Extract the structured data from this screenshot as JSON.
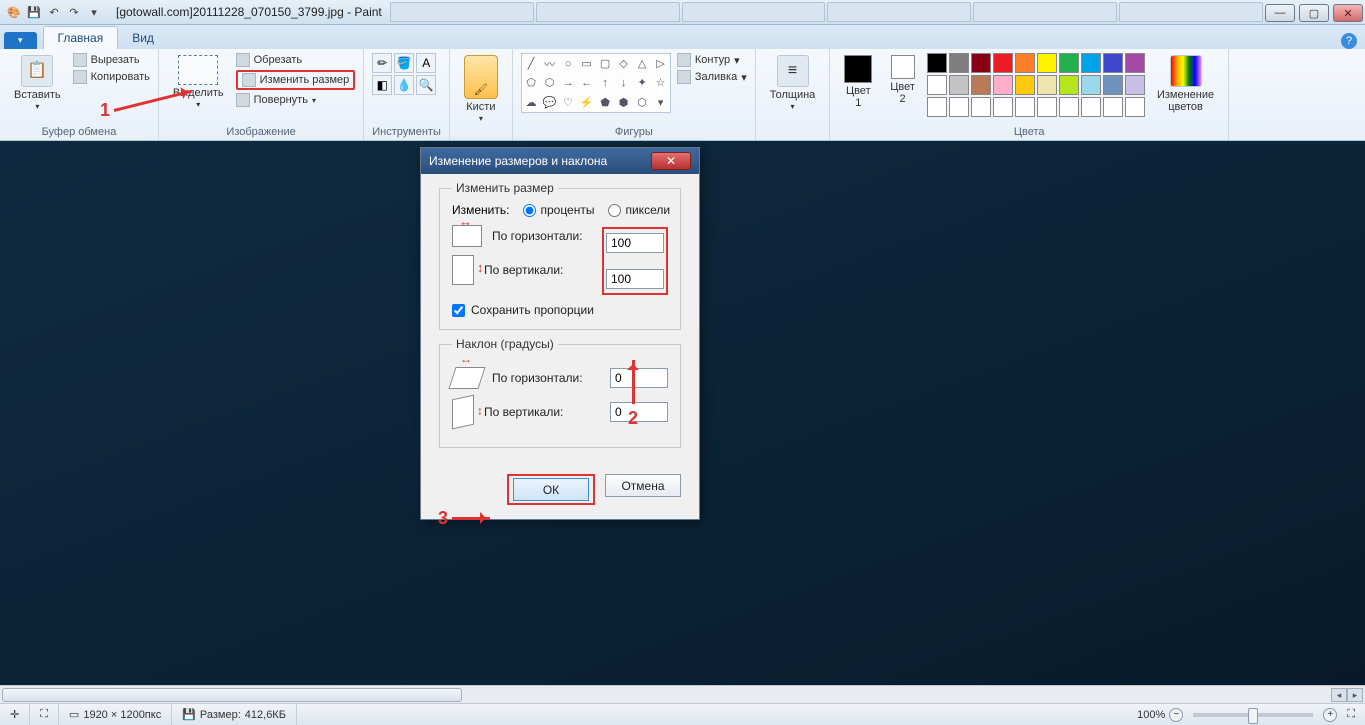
{
  "title": "[gotowall.com]20111228_070150_3799.jpg - Paint",
  "ribbon_tabs": {
    "home": "Главная",
    "view": "Вид"
  },
  "groups": {
    "clipboard": {
      "label": "Буфер обмена",
      "paste": "Вставить",
      "cut": "Вырезать",
      "copy": "Копировать"
    },
    "image": {
      "label": "Изображение",
      "select": "Выделить",
      "crop": "Обрезать",
      "resize": "Изменить размер",
      "rotate": "Повернуть"
    },
    "tools": {
      "label": "Инструменты"
    },
    "brush": {
      "label": "Кисти"
    },
    "shapes": {
      "label": "Фигуры",
      "outline": "Контур",
      "fill": "Заливка"
    },
    "thickness": {
      "label": "Толщина"
    },
    "colors": {
      "label": "Цвета",
      "c1": "Цвет\n1",
      "c2": "Цвет\n2",
      "edit": "Изменение\nцветов"
    }
  },
  "palette_row1": [
    "#000000",
    "#7f7f7f",
    "#880015",
    "#ed1c24",
    "#ff7f27",
    "#fff200",
    "#22b14c",
    "#00a2e8",
    "#3f48cc",
    "#a349a4"
  ],
  "palette_row2": [
    "#ffffff",
    "#c3c3c3",
    "#b97a57",
    "#ffaec9",
    "#ffc90e",
    "#efe4b0",
    "#b5e61d",
    "#99d9ea",
    "#7092be",
    "#c8bfe7"
  ],
  "palette_row3": [
    "#ffffff",
    "#ffffff",
    "#ffffff",
    "#ffffff",
    "#ffffff",
    "#ffffff",
    "#ffffff",
    "#ffffff",
    "#ffffff",
    "#ffffff"
  ],
  "dialog": {
    "title": "Изменение размеров и наклона",
    "resize_legend": "Изменить размер",
    "change_label": "Изменить:",
    "percent": "проценты",
    "pixels": "пиксели",
    "horiz": "По горизонтали:",
    "vert": "По вертикали:",
    "h_val": "100",
    "v_val": "100",
    "keep_ratio": "Сохранить пропорции",
    "skew_legend": "Наклон (градусы)",
    "skew_h_val": "0",
    "skew_v_val": "0",
    "ok": "ОК",
    "cancel": "Отмена"
  },
  "status": {
    "dims": "1920 × 1200пкс",
    "size_label": "Размер:",
    "size_val": "412,6КБ",
    "zoom": "100%"
  },
  "annot": {
    "n1": "1",
    "n2": "2",
    "n3": "3"
  }
}
